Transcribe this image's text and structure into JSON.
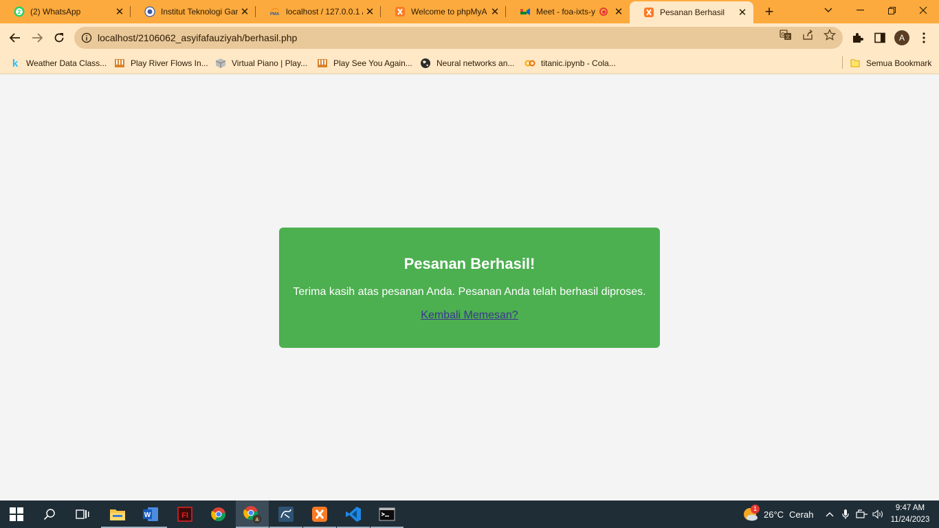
{
  "browser": {
    "tabs": [
      {
        "title": "(2) WhatsApp",
        "icon": "whatsapp-icon",
        "badge": "2"
      },
      {
        "title": "Institut Teknologi Gar",
        "icon": "itg-logo-icon"
      },
      {
        "title": "localhost / 127.0.0.1 /",
        "icon": "phpmyadmin-icon"
      },
      {
        "title": "Welcome to phpMyA",
        "icon": "xampp-icon"
      },
      {
        "title": "Meet - foa-ixts-y",
        "icon": "google-meet-icon"
      },
      {
        "title": "Pesanan Berhasil",
        "icon": "xampp-icon"
      }
    ],
    "url": "localhost/2106062_asyifafauziyah/berhasil.php",
    "profile_initial": "A",
    "bookmarks": [
      {
        "label": "Weather Data Class...",
        "icon": "kaggle-icon"
      },
      {
        "label": "Play River Flows In...",
        "icon": "piano-icon"
      },
      {
        "label": "Virtual Piano | Play...",
        "icon": "cube-icon"
      },
      {
        "label": "Play See You Again...",
        "icon": "piano-icon"
      },
      {
        "label": "Neural networks an...",
        "icon": "globe-icon"
      },
      {
        "label": "titanic.ipynb - Cola...",
        "icon": "colab-icon"
      }
    ],
    "all_bookmarks_label": "Semua Bookmark"
  },
  "page": {
    "heading": "Pesanan Berhasil!",
    "message": "Terima kasih atas pesanan Anda. Pesanan Anda telah berhasil diproses.",
    "link_label": "Kembali Memesan?"
  },
  "taskbar": {
    "weather_temp": "26°C",
    "weather_desc": "Cerah",
    "weather_badge": "1",
    "time": "9:47 AM",
    "date": "11/24/2023"
  },
  "colors": {
    "tab_strip": "#fcaa3d",
    "toolbar": "#ffe8c6",
    "card_green": "#4caf50",
    "link": "#3b3590",
    "taskbar": "#1f2d36"
  }
}
